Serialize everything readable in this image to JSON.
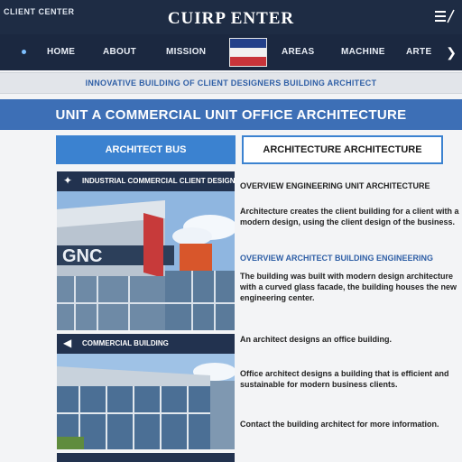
{
  "topbar": {
    "left_text": "CLIENT CENTER",
    "brand": "CUIRP ENTER",
    "menu_icon": "hamburger-icon"
  },
  "nav": {
    "items": [
      {
        "label": "HOME"
      },
      {
        "label": "ABOUT"
      },
      {
        "label": "MISSION"
      },
      {
        "label": "AREAS"
      },
      {
        "label": "MACHINE"
      },
      {
        "label": "ARTE"
      }
    ],
    "chevron_icon": "chevron-right-icon"
  },
  "announcement": {
    "text": "INNOVATIVE BUILDING OF CLIENT DESIGNERS BUILDING ARCHITECT"
  },
  "hero": {
    "title": "UNIT A COMMERCIAL UNIT OFFICE ARCHITECTURE"
  },
  "buttons": {
    "primary": "ARCHITECT BUS",
    "secondary": "ARCHITECTURE ARCHITECTURE"
  },
  "cards": [
    {
      "icon": "arrow-icon",
      "title": "INDUSTRIAL COMMERCIAL CLIENT DESIGN"
    },
    {
      "icon": "speaker-icon",
      "title": "COMMERCIAL BUILDING"
    },
    {
      "icon": "",
      "title": ""
    }
  ],
  "content": {
    "heading": "OVERVIEW ENGINEERING UNIT ARCHITECTURE",
    "para1": "Architecture creates the client building for a client with a modern design, using the client design of the business.",
    "subheading": "OVERVIEW ARCHITECT BUILDING ENGINEERING",
    "para2": "The building was built with modern design architecture with a curved glass facade, the building houses the new engineering center.",
    "heading2": "An architect designs an office building.",
    "para3": "Office architect designs a building that is efficient and sustainable for modern business clients.",
    "footer": "Contact the building architect for more information."
  },
  "colors": {
    "topbar": "#1e2c44",
    "nav": "#1b2840",
    "hero": "#3d6fb6",
    "accent": "#3b82d0",
    "announce_text": "#2f5fa6"
  }
}
